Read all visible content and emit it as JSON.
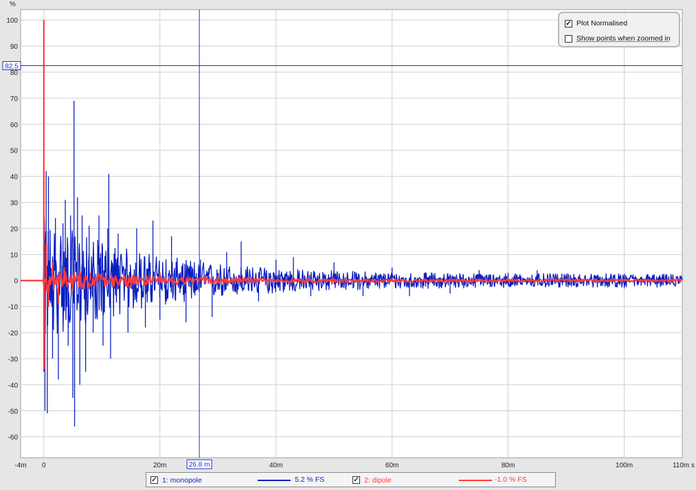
{
  "chart_data": {
    "type": "line",
    "title": "",
    "xlabel": "s",
    "ylabel": "%",
    "xlim": [
      -0.004,
      0.11
    ],
    "ylim": [
      -68,
      104
    ],
    "x_ticks": [
      {
        "value": -0.004,
        "label": "-4m"
      },
      {
        "value": 0,
        "label": "0"
      },
      {
        "value": 0.02,
        "label": "20m"
      },
      {
        "value": 0.04,
        "label": "40m"
      },
      {
        "value": 0.06,
        "label": "60m"
      },
      {
        "value": 0.08,
        "label": "80m"
      },
      {
        "value": 0.1,
        "label": "100m"
      },
      {
        "value": 0.11,
        "label": "110m s"
      }
    ],
    "y_ticks": [
      100,
      90,
      80,
      70,
      60,
      50,
      40,
      30,
      20,
      10,
      0,
      -10,
      -20,
      -30,
      -40,
      -50,
      -60
    ],
    "grid": true,
    "cursor": {
      "x": 0.0268,
      "x_label": "26.8 m",
      "y": 82.5,
      "y_label": "82.5"
    },
    "series": [
      {
        "name": "1: monopole",
        "color": "#0a1fbf",
        "level_label": "5.2 % FS",
        "peaks": [
          {
            "x": 0.0,
            "y": -35
          },
          {
            "x": 0.0002,
            "y": -50
          },
          {
            "x": 0.0004,
            "y": 42
          },
          {
            "x": 0.0006,
            "y": -51
          },
          {
            "x": 0.0008,
            "y": 40
          },
          {
            "x": 0.0015,
            "y": -30
          },
          {
            "x": 0.002,
            "y": 24
          },
          {
            "x": 0.0025,
            "y": -38
          },
          {
            "x": 0.0033,
            "y": 22
          },
          {
            "x": 0.0037,
            "y": 31
          },
          {
            "x": 0.0042,
            "y": -25
          },
          {
            "x": 0.0046,
            "y": 25
          },
          {
            "x": 0.005,
            "y": -45
          },
          {
            "x": 0.0052,
            "y": 69
          },
          {
            "x": 0.0053,
            "y": -56
          },
          {
            "x": 0.0058,
            "y": 32
          },
          {
            "x": 0.0062,
            "y": -40
          },
          {
            "x": 0.0066,
            "y": 25
          },
          {
            "x": 0.0072,
            "y": -35
          },
          {
            "x": 0.0078,
            "y": 21
          },
          {
            "x": 0.0085,
            "y": -20
          },
          {
            "x": 0.0095,
            "y": 25
          },
          {
            "x": 0.0102,
            "y": -25
          },
          {
            "x": 0.011,
            "y": 20
          },
          {
            "x": 0.0112,
            "y": 41
          },
          {
            "x": 0.0115,
            "y": -30
          },
          {
            "x": 0.0128,
            "y": 18
          },
          {
            "x": 0.0145,
            "y": -20
          },
          {
            "x": 0.016,
            "y": 20
          },
          {
            "x": 0.0175,
            "y": -18
          },
          {
            "x": 0.0188,
            "y": 23
          },
          {
            "x": 0.02,
            "y": -15
          },
          {
            "x": 0.022,
            "y": 17
          },
          {
            "x": 0.0245,
            "y": -16
          },
          {
            "x": 0.027,
            "y": 8
          },
          {
            "x": 0.029,
            "y": -14
          },
          {
            "x": 0.0315,
            "y": 11
          },
          {
            "x": 0.034,
            "y": 15
          },
          {
            "x": 0.037,
            "y": -8
          },
          {
            "x": 0.04,
            "y": 8
          },
          {
            "x": 0.043,
            "y": 9
          },
          {
            "x": 0.046,
            "y": -6
          },
          {
            "x": 0.05,
            "y": 7
          },
          {
            "x": 0.055,
            "y": -6
          },
          {
            "x": 0.06,
            "y": 5
          },
          {
            "x": 0.063,
            "y": -6
          },
          {
            "x": 0.07,
            "y": -5
          },
          {
            "x": 0.075,
            "y": 4
          },
          {
            "x": 0.08,
            "y": 3
          },
          {
            "x": 0.085,
            "y": 4
          },
          {
            "x": 0.09,
            "y": -2
          },
          {
            "x": 0.095,
            "y": 2
          },
          {
            "x": 0.1,
            "y": -3
          },
          {
            "x": 0.105,
            "y": 2
          },
          {
            "x": 0.11,
            "y": 1
          }
        ]
      },
      {
        "name": "2: dipole",
        "color": "#ff3a3a",
        "level_label": "-1.0 % FS",
        "peaks": [
          {
            "x": 0.0,
            "y": 100
          },
          {
            "x": 0.0001,
            "y": -34
          },
          {
            "x": 0.0004,
            "y": 14
          },
          {
            "x": 0.0008,
            "y": -10
          },
          {
            "x": 0.0015,
            "y": 7
          },
          {
            "x": 0.0025,
            "y": -9
          },
          {
            "x": 0.0035,
            "y": 5
          },
          {
            "x": 0.005,
            "y": -4
          },
          {
            "x": 0.008,
            "y": 3
          },
          {
            "x": 0.015,
            "y": -3
          },
          {
            "x": 0.02,
            "y": 3
          },
          {
            "x": 0.03,
            "y": 2
          },
          {
            "x": 0.05,
            "y": -1
          },
          {
            "x": 0.08,
            "y": 1
          },
          {
            "x": 0.11,
            "y": 0.5
          }
        ]
      }
    ]
  },
  "options": {
    "plot_normalised": {
      "label": "Plot Normalised",
      "checked": true
    },
    "show_points": {
      "label": "Show points when zoomed in",
      "checked": false
    }
  },
  "legend": {
    "item1": {
      "label": "1: monopole",
      "checked": true,
      "color": "#0a1fbf",
      "value": "5.2 % FS"
    },
    "item2": {
      "label": "2: dipole",
      "checked": true,
      "color": "#ff3a3a",
      "value": "-1.0 % FS"
    }
  }
}
